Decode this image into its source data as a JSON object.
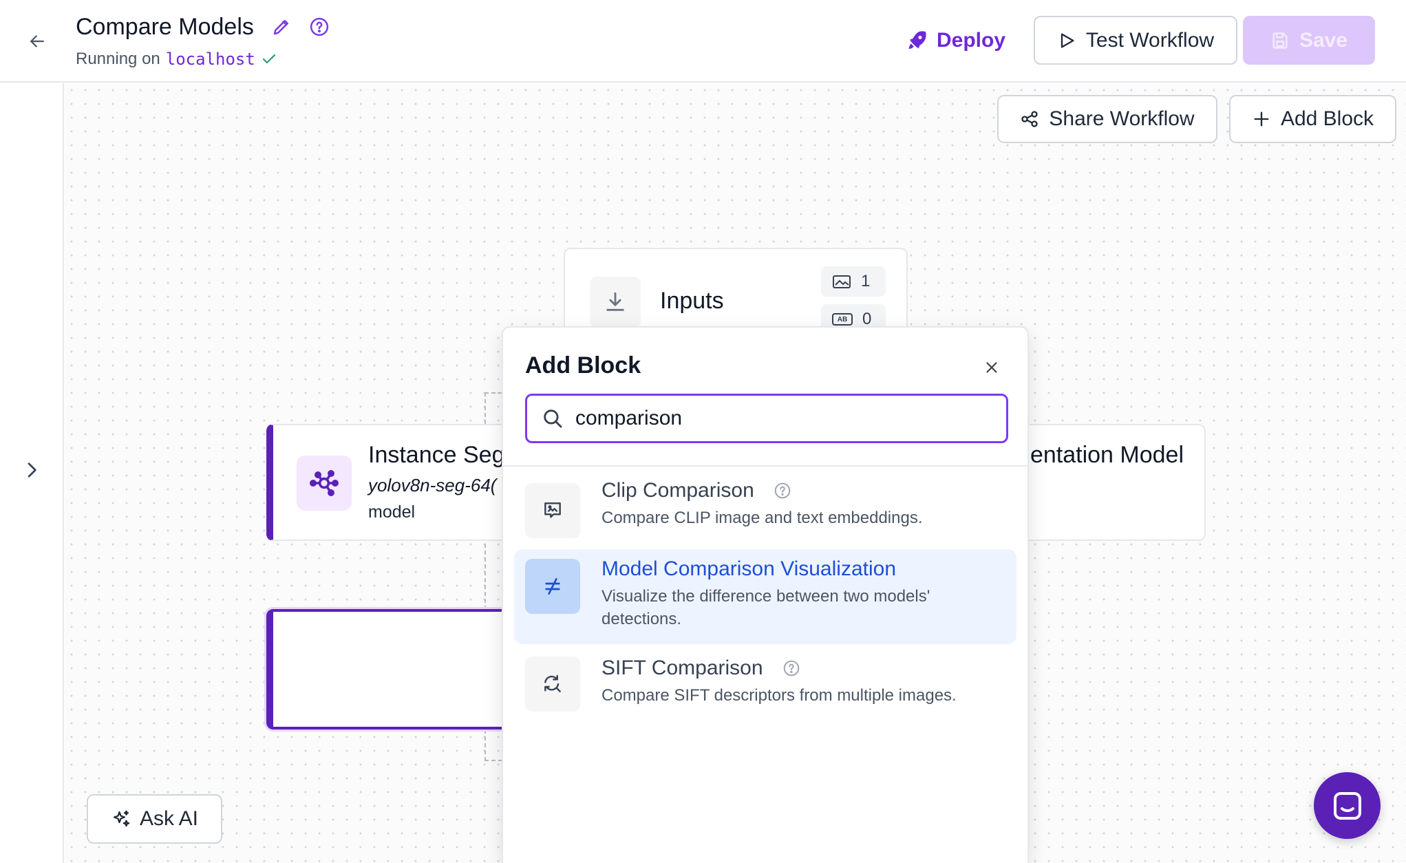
{
  "header": {
    "title": "Compare Models",
    "running_prefix": "Running on",
    "host": "localhost",
    "deploy_label": "Deploy",
    "test_label": "Test Workflow",
    "save_label": "Save"
  },
  "toolbar": {
    "share_label": "Share Workflow",
    "add_block_label": "Add Block"
  },
  "canvas": {
    "inputs_node": {
      "label": "Inputs",
      "image_count": "1",
      "param_count": "0",
      "param_badge": "AB"
    },
    "left_node": {
      "title": "Instance Seg",
      "model": "yolov8n-seg-64(",
      "kind": "model"
    },
    "right_node": {
      "title": "entation Model"
    },
    "ask_ai_label": "Ask AI"
  },
  "add_block_modal": {
    "title": "Add Block",
    "search_value": "comparison",
    "results": [
      {
        "name": "Clip Comparison",
        "description": "Compare CLIP image and text embeddings.",
        "icon": "image-compare-icon",
        "has_help": true
      },
      {
        "name": "Model Comparison Visualization",
        "description": "Visualize the difference between two models' detections.",
        "icon": "not-equal-icon",
        "has_help": false
      },
      {
        "name": "SIFT Comparison",
        "description": "Compare SIFT descriptors from multiple images.",
        "icon": "search-refresh-icon",
        "has_help": true
      }
    ]
  },
  "colors": {
    "accent": "#6d28d9",
    "active_row": "#eef4ff",
    "active_text": "#1d4ed8"
  }
}
